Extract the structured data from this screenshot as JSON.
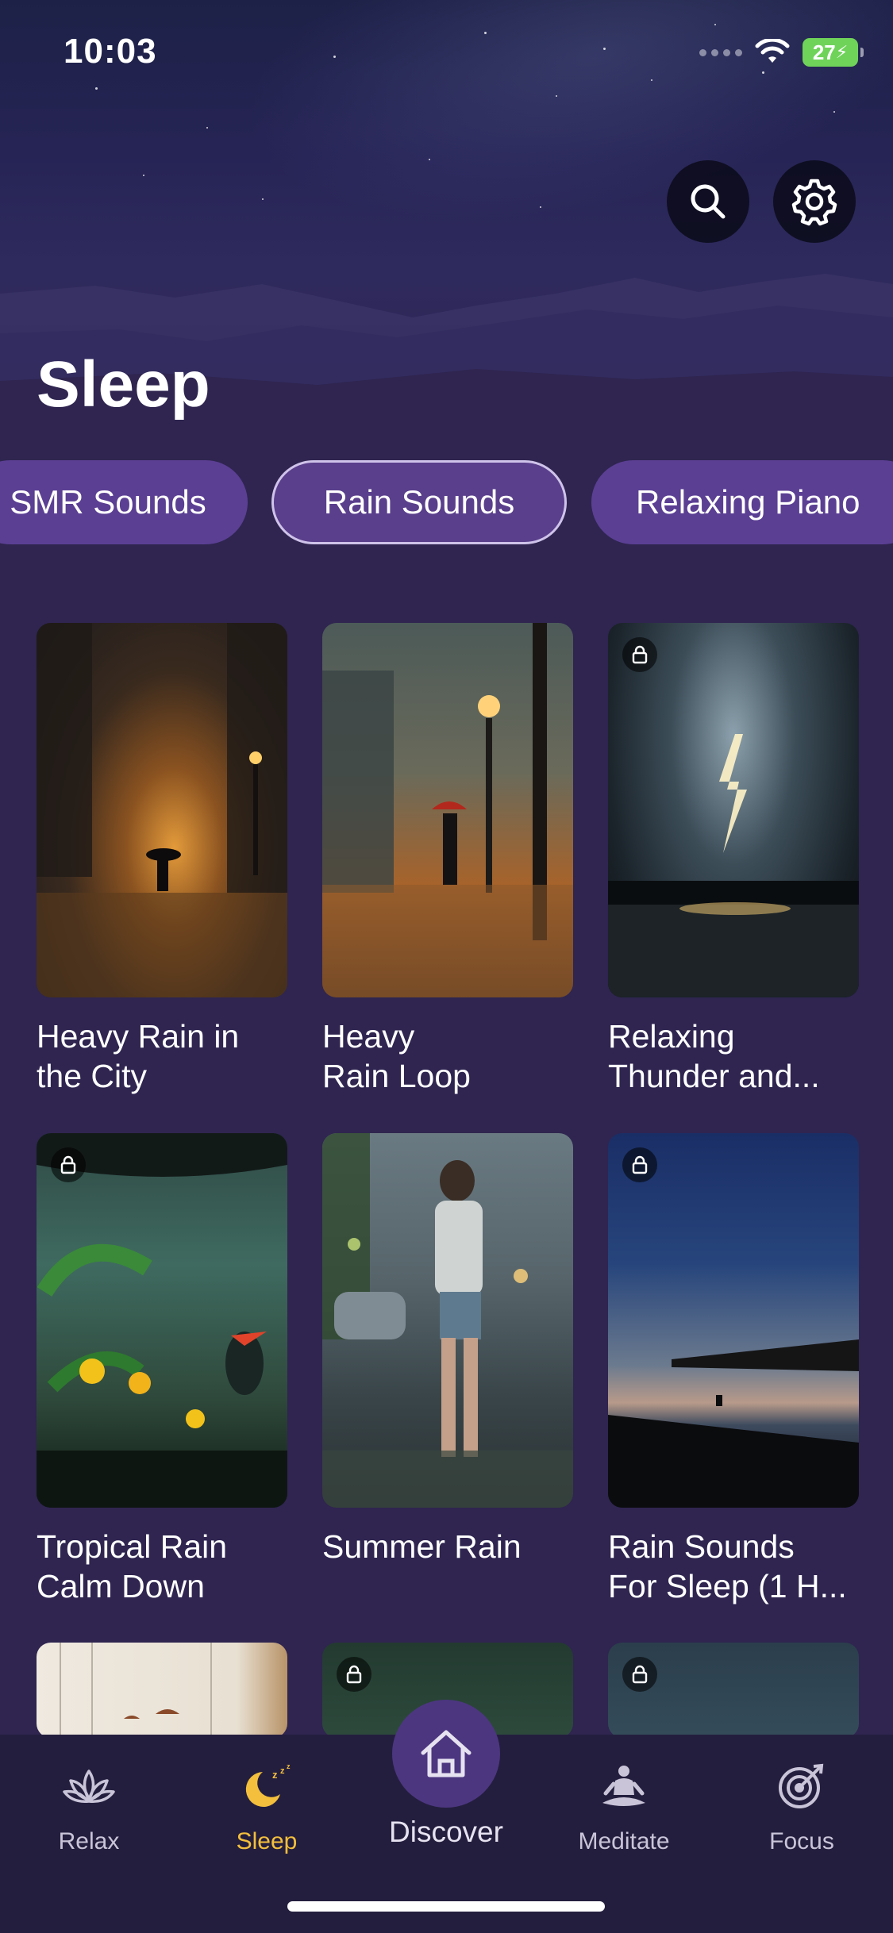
{
  "status_bar": {
    "time": "10:03",
    "battery": "27"
  },
  "header": {
    "title": "Sleep",
    "search_icon": "search-icon",
    "settings_icon": "gear-icon"
  },
  "categories": [
    {
      "label": "SMR Sounds"
    },
    {
      "label": "Rain Sounds",
      "selected": true
    },
    {
      "label": "Relaxing Piano"
    }
  ],
  "tracks": [
    {
      "title": "Heavy Rain in\nthe City",
      "locked": false
    },
    {
      "title": "Heavy\nRain Loop",
      "locked": false
    },
    {
      "title": "Relaxing\nThunder and...",
      "locked": true
    },
    {
      "title": "Tropical Rain\nCalm Down",
      "locked": true
    },
    {
      "title": "Summer Rain",
      "locked": false
    },
    {
      "title": "Rain Sounds\nFor Sleep (1 H...",
      "locked": true
    },
    {
      "title": "",
      "locked": false
    },
    {
      "title": "",
      "locked": true
    },
    {
      "title": "",
      "locked": true
    }
  ],
  "nav": {
    "relax": "Relax",
    "sleep": "Sleep",
    "discover": "Discover",
    "meditate": "Meditate",
    "focus": "Focus"
  },
  "colors": {
    "background": "#2f2550",
    "chip": "#5b3f93",
    "active_nav": "#f3bf3c",
    "nav_bar": "#241e3e"
  }
}
